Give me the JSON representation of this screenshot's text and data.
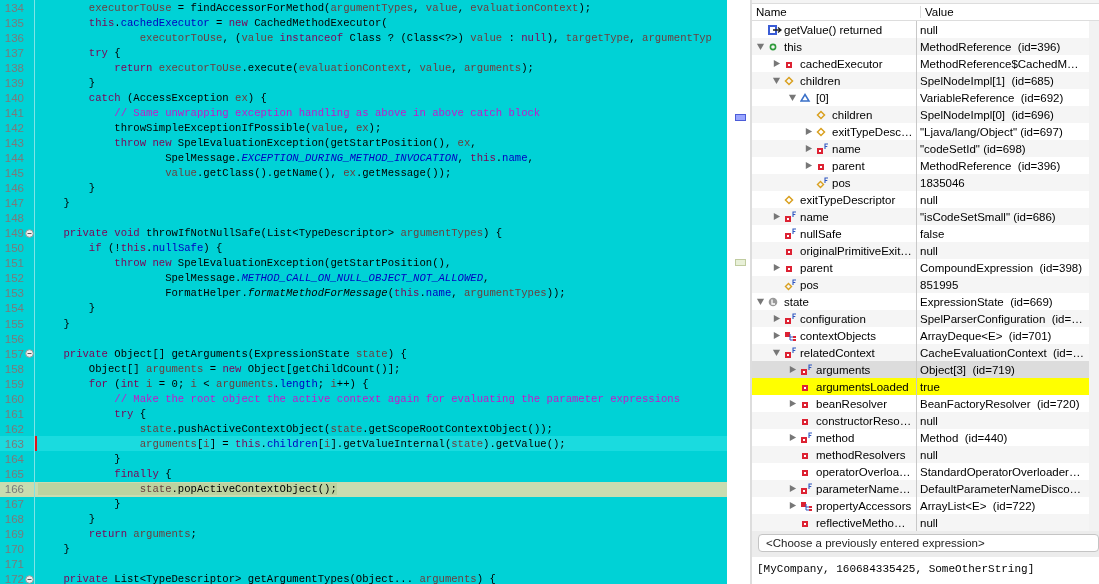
{
  "editor": {
    "lines": [
      {
        "n": "134",
        "current": false,
        "selected": false,
        "foldable": false,
        "tokens": [
          {
            "kind": "var",
            "text": "        executorToUse"
          },
          {
            "kind": "plain",
            "text": " = findAccessorForMethod("
          },
          {
            "kind": "var",
            "text": "argumentTypes"
          },
          {
            "kind": "plain",
            "text": ", "
          },
          {
            "kind": "var",
            "text": "value"
          },
          {
            "kind": "plain",
            "text": ", "
          },
          {
            "kind": "var",
            "text": "evaluationContext"
          },
          {
            "kind": "plain",
            "text": ");"
          }
        ]
      },
      {
        "n": "135",
        "current": false,
        "selected": false,
        "foldable": false,
        "tokens": [
          {
            "kind": "kw",
            "text": "        this"
          },
          {
            "kind": "plain",
            "text": "."
          },
          {
            "kind": "field",
            "text": "cachedExecutor"
          },
          {
            "kind": "plain",
            "text": " = "
          },
          {
            "kind": "kw",
            "text": "new"
          },
          {
            "kind": "plain",
            "text": " CachedMethodExecutor("
          }
        ]
      },
      {
        "n": "136",
        "current": false,
        "selected": false,
        "foldable": false,
        "tokens": [
          {
            "kind": "var",
            "text": "                executorToUse"
          },
          {
            "kind": "plain",
            "text": ", ("
          },
          {
            "kind": "var",
            "text": "value"
          },
          {
            "kind": "kw",
            "text": " instanceof"
          },
          {
            "kind": "plain",
            "text": " Class ? (Class<?>) "
          },
          {
            "kind": "var",
            "text": "value"
          },
          {
            "kind": "plain",
            "text": " : "
          },
          {
            "kind": "kw",
            "text": "null"
          },
          {
            "kind": "plain",
            "text": "), "
          },
          {
            "kind": "var",
            "text": "targetType"
          },
          {
            "kind": "plain",
            "text": ", "
          },
          {
            "kind": "var",
            "text": "argumentTyp"
          }
        ]
      },
      {
        "n": "137",
        "current": false,
        "selected": false,
        "foldable": false,
        "tokens": [
          {
            "kind": "kw",
            "text": "        try"
          },
          {
            "kind": "plain",
            "text": " {"
          }
        ]
      },
      {
        "n": "138",
        "current": false,
        "selected": false,
        "foldable": false,
        "tokens": [
          {
            "kind": "kw",
            "text": "            return"
          },
          {
            "kind": "var",
            "text": " executorToUse"
          },
          {
            "kind": "plain",
            "text": ".execute("
          },
          {
            "kind": "var",
            "text": "evaluationContext"
          },
          {
            "kind": "plain",
            "text": ", "
          },
          {
            "kind": "var",
            "text": "value"
          },
          {
            "kind": "plain",
            "text": ", "
          },
          {
            "kind": "var",
            "text": "arguments"
          },
          {
            "kind": "plain",
            "text": ");"
          }
        ]
      },
      {
        "n": "139",
        "current": false,
        "selected": false,
        "foldable": false,
        "tokens": [
          {
            "kind": "plain",
            "text": "        }"
          }
        ]
      },
      {
        "n": "140",
        "current": false,
        "selected": false,
        "foldable": false,
        "tokens": [
          {
            "kind": "kw",
            "text": "        catch"
          },
          {
            "kind": "plain",
            "text": " (AccessException "
          },
          {
            "kind": "var",
            "text": "ex"
          },
          {
            "kind": "plain",
            "text": ") {"
          }
        ]
      },
      {
        "n": "141",
        "current": false,
        "selected": false,
        "foldable": false,
        "tokens": [
          {
            "kind": "comment",
            "text": "            // Same unwrapping exception handling as above in above catch block"
          }
        ]
      },
      {
        "n": "142",
        "current": false,
        "selected": false,
        "foldable": false,
        "tokens": [
          {
            "kind": "plain",
            "text": "            throwSimpleExceptionIfPossible("
          },
          {
            "kind": "var",
            "text": "value"
          },
          {
            "kind": "plain",
            "text": ", "
          },
          {
            "kind": "var",
            "text": "ex"
          },
          {
            "kind": "plain",
            "text": ");"
          }
        ]
      },
      {
        "n": "143",
        "current": false,
        "selected": false,
        "foldable": false,
        "tokens": [
          {
            "kind": "kw",
            "text": "            throw"
          },
          {
            "kind": "kw",
            "text": " new"
          },
          {
            "kind": "plain",
            "text": " SpelEvaluationException(getStartPosition(), "
          },
          {
            "kind": "var",
            "text": "ex"
          },
          {
            "kind": "plain",
            "text": ","
          }
        ]
      },
      {
        "n": "144",
        "current": false,
        "selected": false,
        "foldable": false,
        "tokens": [
          {
            "kind": "plain",
            "text": "                    SpelMessage."
          },
          {
            "kind": "const",
            "text": "EXCEPTION_DURING_METHOD_INVOCATION"
          },
          {
            "kind": "plain",
            "text": ", "
          },
          {
            "kind": "kw",
            "text": "this"
          },
          {
            "kind": "plain",
            "text": "."
          },
          {
            "kind": "field",
            "text": "name"
          },
          {
            "kind": "plain",
            "text": ","
          }
        ]
      },
      {
        "n": "145",
        "current": false,
        "selected": false,
        "foldable": false,
        "tokens": [
          {
            "kind": "var",
            "text": "                    value"
          },
          {
            "kind": "plain",
            "text": ".getClass().getName(), "
          },
          {
            "kind": "var",
            "text": "ex"
          },
          {
            "kind": "plain",
            "text": ".getMessage());"
          }
        ]
      },
      {
        "n": "146",
        "current": false,
        "selected": false,
        "foldable": false,
        "tokens": [
          {
            "kind": "plain",
            "text": "        }"
          }
        ]
      },
      {
        "n": "147",
        "current": false,
        "selected": false,
        "foldable": false,
        "tokens": [
          {
            "kind": "plain",
            "text": "    }"
          }
        ]
      },
      {
        "n": "148",
        "current": false,
        "selected": false,
        "foldable": false
      },
      {
        "n": "149",
        "current": false,
        "selected": false,
        "foldable": true,
        "tokens": [
          {
            "kind": "kw",
            "text": "    private"
          },
          {
            "kind": "kw",
            "text": " void"
          },
          {
            "kind": "plain",
            "text": " throwIfNotNullSafe(List<TypeDescriptor> "
          },
          {
            "kind": "var",
            "text": "argumentTypes"
          },
          {
            "kind": "plain",
            "text": ") {"
          }
        ]
      },
      {
        "n": "150",
        "current": false,
        "selected": false,
        "foldable": false,
        "tokens": [
          {
            "kind": "kw",
            "text": "        if"
          },
          {
            "kind": "plain",
            "text": " (!"
          },
          {
            "kind": "kw",
            "text": "this"
          },
          {
            "kind": "plain",
            "text": "."
          },
          {
            "kind": "field",
            "text": "nullSafe"
          },
          {
            "kind": "plain",
            "text": ") {"
          }
        ]
      },
      {
        "n": "151",
        "current": false,
        "selected": false,
        "foldable": false,
        "tokens": [
          {
            "kind": "kw",
            "text": "            throw"
          },
          {
            "kind": "kw",
            "text": " new"
          },
          {
            "kind": "plain",
            "text": " SpelEvaluationException(getStartPosition(),"
          }
        ]
      },
      {
        "n": "152",
        "current": false,
        "selected": false,
        "foldable": false,
        "tokens": [
          {
            "kind": "plain",
            "text": "                    SpelMessage."
          },
          {
            "kind": "const",
            "text": "METHOD_CALL_ON_NULL_OBJECT_NOT_ALLOWED"
          },
          {
            "kind": "plain",
            "text": ","
          }
        ]
      },
      {
        "n": "153",
        "current": false,
        "selected": false,
        "foldable": false,
        "tokens": [
          {
            "kind": "plain",
            "text": "                    FormatHelper."
          },
          {
            "kind": "static",
            "text": "formatMethodForMessage"
          },
          {
            "kind": "plain",
            "text": "("
          },
          {
            "kind": "kw",
            "text": "this"
          },
          {
            "kind": "plain",
            "text": "."
          },
          {
            "kind": "field",
            "text": "name"
          },
          {
            "kind": "plain",
            "text": ", "
          },
          {
            "kind": "var",
            "text": "argumentTypes"
          },
          {
            "kind": "plain",
            "text": "));"
          }
        ]
      },
      {
        "n": "154",
        "current": false,
        "selected": false,
        "foldable": false,
        "tokens": [
          {
            "kind": "plain",
            "text": "        }"
          }
        ]
      },
      {
        "n": "155",
        "current": false,
        "selected": false,
        "foldable": false,
        "tokens": [
          {
            "kind": "plain",
            "text": "    }"
          }
        ]
      },
      {
        "n": "156",
        "current": false,
        "selected": false,
        "foldable": false
      },
      {
        "n": "157",
        "current": false,
        "selected": false,
        "foldable": true,
        "tokens": [
          {
            "kind": "kw",
            "text": "    private"
          },
          {
            "kind": "plain",
            "text": " Object[] getArguments(ExpressionState "
          },
          {
            "kind": "var",
            "text": "state"
          },
          {
            "kind": "plain",
            "text": ") {"
          }
        ]
      },
      {
        "n": "158",
        "current": false,
        "selected": false,
        "foldable": false,
        "tokens": [
          {
            "kind": "plain",
            "text": "        Object[] "
          },
          {
            "kind": "var",
            "text": "arguments"
          },
          {
            "kind": "plain",
            "text": " = "
          },
          {
            "kind": "kw",
            "text": "new"
          },
          {
            "kind": "plain",
            "text": " Object[getChildCount()];"
          }
        ]
      },
      {
        "n": "159",
        "current": false,
        "selected": false,
        "foldable": false,
        "tokens": [
          {
            "kind": "kw",
            "text": "        for"
          },
          {
            "kind": "plain",
            "text": " ("
          },
          {
            "kind": "kw",
            "text": "int"
          },
          {
            "kind": "var",
            "text": " i"
          },
          {
            "kind": "plain",
            "text": " = 0; "
          },
          {
            "kind": "var",
            "text": "i"
          },
          {
            "kind": "plain",
            "text": " < "
          },
          {
            "kind": "var",
            "text": "arguments"
          },
          {
            "kind": "plain",
            "text": "."
          },
          {
            "kind": "field",
            "text": "length"
          },
          {
            "kind": "plain",
            "text": "; "
          },
          {
            "kind": "var",
            "text": "i"
          },
          {
            "kind": "plain",
            "text": "++) {"
          }
        ]
      },
      {
        "n": "160",
        "current": false,
        "selected": false,
        "foldable": false,
        "tokens": [
          {
            "kind": "comment",
            "text": "            // Make the root object the active context again for evaluating the parameter expressions"
          }
        ]
      },
      {
        "n": "161",
        "current": false,
        "selected": false,
        "foldable": false,
        "tokens": [
          {
            "kind": "kw",
            "text": "            try"
          },
          {
            "kind": "plain",
            "text": " {"
          }
        ]
      },
      {
        "n": "162",
        "current": false,
        "selected": false,
        "foldable": false,
        "tokens": [
          {
            "kind": "var",
            "text": "                state"
          },
          {
            "kind": "plain",
            "text": ".pushActiveContextObject("
          },
          {
            "kind": "var",
            "text": "state"
          },
          {
            "kind": "plain",
            "text": ".getScopeRootContextObject());"
          }
        ]
      },
      {
        "n": "163",
        "current": true,
        "selected": false,
        "foldable": false,
        "tokens": [
          {
            "kind": "var",
            "text": "                arguments"
          },
          {
            "kind": "plain",
            "text": "["
          },
          {
            "kind": "var",
            "text": "i"
          },
          {
            "kind": "plain",
            "text": "] = "
          },
          {
            "kind": "kw",
            "text": "this"
          },
          {
            "kind": "plain",
            "text": "."
          },
          {
            "kind": "field",
            "text": "children"
          },
          {
            "kind": "plain",
            "text": "["
          },
          {
            "kind": "var",
            "text": "i"
          },
          {
            "kind": "plain",
            "text": "].getValueInternal("
          },
          {
            "kind": "var",
            "text": "state"
          },
          {
            "kind": "plain",
            "text": ").getValue();"
          }
        ]
      },
      {
        "n": "164",
        "current": false,
        "selected": false,
        "foldable": false,
        "tokens": [
          {
            "kind": "plain",
            "text": "            }"
          }
        ]
      },
      {
        "n": "165",
        "current": false,
        "selected": false,
        "foldable": false,
        "tokens": [
          {
            "kind": "kw",
            "text": "            finally"
          },
          {
            "kind": "plain",
            "text": " {"
          }
        ]
      },
      {
        "n": "166",
        "current": false,
        "selected": true,
        "foldable": false,
        "tokens": [
          {
            "kind": "var",
            "text": "                state"
          },
          {
            "kind": "plain",
            "text": ".popActiveContextObject();"
          }
        ]
      },
      {
        "n": "167",
        "current": false,
        "selected": false,
        "foldable": false,
        "tokens": [
          {
            "kind": "plain",
            "text": "            }"
          }
        ]
      },
      {
        "n": "168",
        "current": false,
        "selected": false,
        "foldable": false,
        "tokens": [
          {
            "kind": "plain",
            "text": "        }"
          }
        ]
      },
      {
        "n": "169",
        "current": false,
        "selected": false,
        "foldable": false,
        "tokens": [
          {
            "kind": "kw",
            "text": "        return"
          },
          {
            "kind": "var",
            "text": " arguments"
          },
          {
            "kind": "plain",
            "text": ";"
          }
        ]
      },
      {
        "n": "170",
        "current": false,
        "selected": false,
        "foldable": false,
        "tokens": [
          {
            "kind": "plain",
            "text": "    }"
          }
        ]
      },
      {
        "n": "171",
        "current": false,
        "selected": false,
        "foldable": false
      },
      {
        "n": "172",
        "current": false,
        "selected": false,
        "foldable": true,
        "tokens": [
          {
            "kind": "kw",
            "text": "    private"
          },
          {
            "kind": "plain",
            "text": " List<TypeDescriptor> getArgumentTypes(Object... "
          },
          {
            "kind": "var",
            "text": "arguments"
          },
          {
            "kind": "plain",
            "text": ") {"
          }
        ]
      }
    ]
  },
  "variables": {
    "columns": [
      "Name",
      "Value"
    ],
    "items": [
      {
        "name": "getValue() returned",
        "value": "null",
        "kind": "return",
        "expandable": false,
        "selected": false,
        "changed": false
      },
      {
        "name": "this",
        "value": "MethodReference  (id=396)",
        "kind": "local",
        "expandable": true,
        "expanded": true,
        "selected": false,
        "changed": false,
        "children": [
          {
            "name": "cachedExecutor",
            "value": "MethodReference$CachedM…",
            "kind": "private",
            "expandable": true,
            "expanded": false,
            "selected": false,
            "changed": false
          },
          {
            "name": "children",
            "value": "SpelNodeImpl[1]  (id=685)",
            "kind": "default",
            "expandable": true,
            "expanded": true,
            "selected": false,
            "changed": false,
            "children": [
              {
                "name": "[0]",
                "value": "VariableReference  (id=692)",
                "kind": "protected",
                "expandable": true,
                "expanded": true,
                "selected": false,
                "changed": false,
                "children": [
                  {
                    "name": "children",
                    "value": "SpelNodeImpl[0]  (id=696)",
                    "kind": "default",
                    "expandable": false,
                    "selected": false,
                    "changed": false
                  },
                  {
                    "name": "exitTypeDesc…",
                    "value": "\"Ljava/lang/Object\" (id=697)",
                    "kind": "default",
                    "expandable": true,
                    "expanded": false,
                    "selected": false,
                    "changed": false
                  },
                  {
                    "name": "name",
                    "value": "\"codeSetId\" (id=698)",
                    "kind": "private-final",
                    "expandable": true,
                    "expanded": false,
                    "selected": false,
                    "changed": false
                  },
                  {
                    "name": "parent",
                    "value": "MethodReference  (id=396)",
                    "kind": "private",
                    "expandable": true,
                    "expanded": false,
                    "selected": false,
                    "changed": false
                  },
                  {
                    "name": "pos",
                    "value": "1835046",
                    "kind": "default-final",
                    "expandable": false,
                    "selected": false,
                    "changed": false
                  }
                ]
              }
            ]
          },
          {
            "name": "exitTypeDescriptor",
            "value": "null",
            "kind": "default",
            "expandable": false,
            "selected": false,
            "changed": false
          },
          {
            "name": "name",
            "value": "\"isCodeSetSmall\" (id=686)",
            "kind": "private-final",
            "expandable": true,
            "expanded": false,
            "selected": false,
            "changed": false
          },
          {
            "name": "nullSafe",
            "value": "false",
            "kind": "private-final",
            "expandable": false,
            "selected": false,
            "changed": false
          },
          {
            "name": "originalPrimitiveExit…",
            "value": "null",
            "kind": "private",
            "expandable": false,
            "selected": false,
            "changed": false
          },
          {
            "name": "parent",
            "value": "CompoundExpression  (id=398)",
            "kind": "private",
            "expandable": true,
            "expanded": false,
            "selected": false,
            "changed": false
          },
          {
            "name": "pos",
            "value": "851995",
            "kind": "default-final",
            "expandable": false,
            "selected": false,
            "changed": false
          }
        ]
      },
      {
        "name": "state",
        "value": "ExpressionState  (id=669)",
        "kind": "local-l",
        "expandable": true,
        "expanded": true,
        "selected": false,
        "changed": false,
        "children": [
          {
            "name": "configuration",
            "value": "SpelParserConfiguration  (id=…",
            "kind": "private-final",
            "expandable": true,
            "expanded": false,
            "selected": false,
            "changed": false
          },
          {
            "name": "contextObjects",
            "value": "ArrayDeque<E>  (id=701)",
            "kind": "private-tree",
            "expandable": true,
            "expanded": false,
            "selected": false,
            "changed": false
          },
          {
            "name": "relatedContext",
            "value": "CacheEvaluationContext  (id=…",
            "kind": "private-final",
            "expandable": true,
            "expanded": true,
            "selected": false,
            "changed": false,
            "children": [
              {
                "name": "arguments",
                "value": "Object[3]  (id=719)",
                "kind": "private-final",
                "expandable": true,
                "expanded": false,
                "selected": true,
                "changed": false
              },
              {
                "name": "argumentsLoaded",
                "value": "true",
                "kind": "private",
                "expandable": false,
                "selected": false,
                "changed": true
              },
              {
                "name": "beanResolver",
                "value": "BeanFactoryResolver  (id=720)",
                "kind": "private",
                "expandable": true,
                "expanded": false,
                "selected": false,
                "changed": false
              },
              {
                "name": "constructorReso…",
                "value": "null",
                "kind": "private",
                "expandable": false,
                "selected": false,
                "changed": false
              },
              {
                "name": "method",
                "value": "Method  (id=440)",
                "kind": "private-final",
                "expandable": true,
                "expanded": false,
                "selected": false,
                "changed": false
              },
              {
                "name": "methodResolvers",
                "value": "null",
                "kind": "private",
                "expandable": false,
                "selected": false,
                "changed": false
              },
              {
                "name": "operatorOverloa…",
                "value": "StandardOperatorOverloader…",
                "kind": "private",
                "expandable": false,
                "selected": false,
                "changed": false
              },
              {
                "name": "parameterName…",
                "value": "DefaultParameterNameDisco…",
                "kind": "private-final",
                "expandable": true,
                "expanded": false,
                "selected": false,
                "changed": false
              },
              {
                "name": "propertyAccessors",
                "value": "ArrayList<E>  (id=722)",
                "kind": "private-tree",
                "expandable": true,
                "expanded": false,
                "selected": false,
                "changed": false
              },
              {
                "name": "reflectiveMetho…",
                "value": "null",
                "kind": "private",
                "expandable": false,
                "selected": false,
                "changed": false
              }
            ]
          }
        ]
      }
    ]
  },
  "expression": {
    "value": "<Choose a previously entered expression>"
  },
  "result": "[MyCompany, 160684335425, SomeOtherString]"
}
